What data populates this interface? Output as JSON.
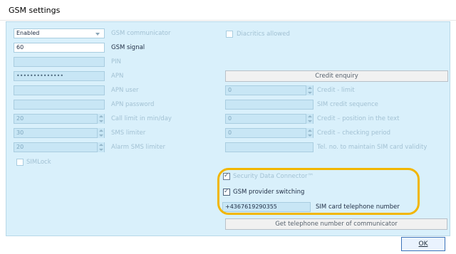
{
  "window": {
    "title": "GSM settings"
  },
  "left": {
    "communicator": {
      "value": "Enabled",
      "label": "GSM communicator"
    },
    "gsm_signal": {
      "value": "60",
      "label": "GSM signal"
    },
    "pin": {
      "label": "PIN"
    },
    "apn": {
      "value": "••••••••••••••",
      "label": "APN"
    },
    "apn_user": {
      "label": "APN user"
    },
    "apn_password": {
      "label": "APN password"
    },
    "call_limit": {
      "value": "20",
      "label": "Call limit in min/day"
    },
    "sms_limiter": {
      "value": "30",
      "label": "SMS limiter"
    },
    "alarm_sms_limiter": {
      "value": "20",
      "label": "Alarm SMS limiter"
    },
    "simlock": {
      "label": "SIMLock",
      "checked": false
    }
  },
  "right": {
    "diacritics": {
      "label": "Diacritics allowed",
      "checked": false
    },
    "credit_enquiry_button": "Credit enquiry",
    "credit_limit": {
      "value": "0",
      "label": "Credit - limit"
    },
    "sim_credit_sequence": {
      "label": "SIM credit sequence"
    },
    "credit_position": {
      "value": "0",
      "label": "Credit – position in the text"
    },
    "credit_checking_period": {
      "value": "0",
      "label": "Credit – checking period"
    },
    "tel_no_validity": {
      "label": "Tel. no. to maintain SIM card validity"
    },
    "security_data_connector": {
      "label": "Security Data Connector™",
      "checked": true
    },
    "gsm_provider_switching": {
      "label": "GSM provider switching",
      "checked": true
    },
    "sim_card_number": {
      "value": "+4367619290355",
      "label": "SIM card telephone number"
    },
    "get_number_button": "Get telephone number of communicator"
  },
  "footer": {
    "ok_label": "OK"
  },
  "colors": {
    "accent_highlight": "#f2b600",
    "panel_bg": "#d9f0fb"
  }
}
